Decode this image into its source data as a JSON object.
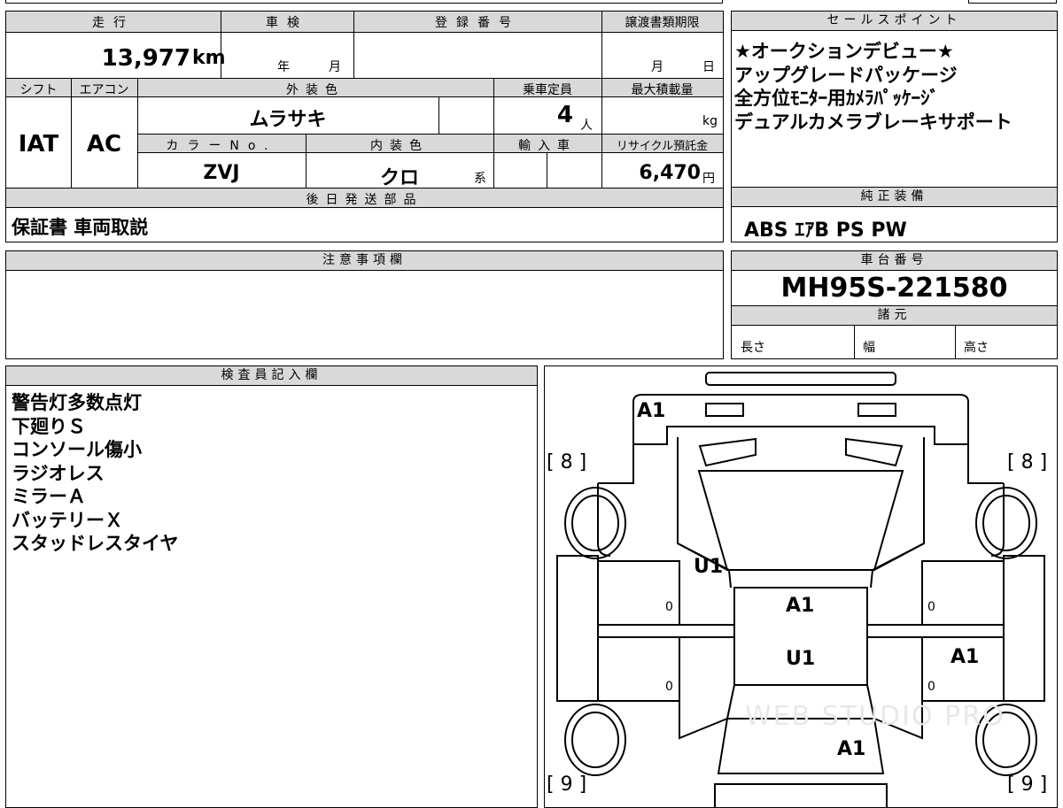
{
  "vehicle": {
    "mileage_label": "走行",
    "mileage_value": "13,977",
    "mileage_unit": "km",
    "inspection_label": "車検",
    "inspection_year": "年",
    "inspection_month": "月",
    "registration_label": "登録番号",
    "transfer_label": "譲渡書類期限",
    "transfer_month": "月",
    "transfer_day": "日",
    "shift_label": "シフト",
    "shift_value": "IAT",
    "ac_label": "エアコン",
    "ac_value": "AC",
    "exterior_label": "外装色",
    "exterior_value": "ムラサキ",
    "capacity_label": "乗車定員",
    "capacity_value": "4",
    "capacity_unit": "人",
    "load_label": "最大積載量",
    "load_unit": "kg",
    "color_no_label": "カラーNo.",
    "color_no_value": "ZVJ",
    "interior_label": "内装色",
    "interior_value": "クロ",
    "interior_unit": "系",
    "import_label": "輸入車",
    "recycle_label": "リサイクル預託金",
    "recycle_value": "6,470",
    "recycle_unit": "円"
  },
  "later_parts": {
    "label": "後日発送部品",
    "value": "保証書 車両取説"
  },
  "sales": {
    "label": "セールスポイント",
    "items": [
      "★オークションデビュー★",
      "アップグレードパッケージ",
      "全方位ﾓﾆﾀｰ用ｶﾒﾗﾊﾟｯｹｰｼﾞ",
      "デュアルカメラブレーキサポート"
    ]
  },
  "genuine": {
    "label": "純正装備",
    "value": "ABS ｴｱB PS PW"
  },
  "notes": {
    "label": "注意事項欄"
  },
  "chassis": {
    "label": "車台番号",
    "value": "MH95S-221580"
  },
  "specs": {
    "label": "諸元",
    "length": "長さ",
    "width": "幅",
    "height": "高さ"
  },
  "inspector": {
    "label": "検査員記入欄",
    "items": [
      "警告灯多数点灯",
      "下廻りＳ",
      "コンソール傷小",
      "ラジオレス",
      "ミラーＡ",
      "バッテリーＸ",
      "スタッドレスタイヤ"
    ]
  },
  "diagram": {
    "tire_front_left": "[ 8 ]",
    "tire_front_right": "[ 8 ]",
    "tire_rear_left": "[ 9 ]",
    "tire_rear_right": "[ 9 ]",
    "mark_bumper": "A1",
    "mark_windshield": "U1",
    "mark_roof": "A1",
    "mark_roof_lower": "U1",
    "mark_right_door": "A1",
    "mark_rear": "A1",
    "door_zero_1": "0",
    "door_zero_2": "0",
    "door_zero_3": "0",
    "door_zero_4": "0",
    "watermark": "WEB STUDIO PRO"
  }
}
